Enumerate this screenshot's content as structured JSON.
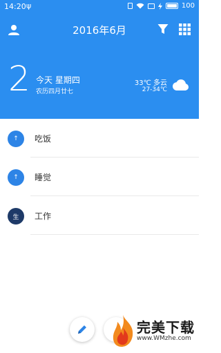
{
  "status_bar": {
    "time": "14:20",
    "usb_symbol": "ψ",
    "battery_level": "100"
  },
  "toolbar": {
    "title": "2016年6月",
    "icons": [
      "user-icon",
      "filter-icon",
      "grid-icon"
    ]
  },
  "day_summary": {
    "day_number": "2",
    "today_label": "今天 星期四",
    "lunar_date": "农历四月廿七",
    "weather": {
      "current": "33℃ 多云",
      "range": "27-34℃",
      "icon": "cloud-icon"
    }
  },
  "tasks": [
    {
      "badge": "↑",
      "label": "吃饭",
      "color": "#2d84e6"
    },
    {
      "badge": "↑",
      "label": "睡觉",
      "color": "#2d84e6"
    },
    {
      "badge": "生",
      "label": "工作",
      "color": "#1e3a68"
    }
  ],
  "watermark": {
    "brand": "完美下载",
    "url": "www.WMzhe.com"
  },
  "colors": {
    "header_bg": "#2b8ef0",
    "accent": "#2d84e6"
  }
}
